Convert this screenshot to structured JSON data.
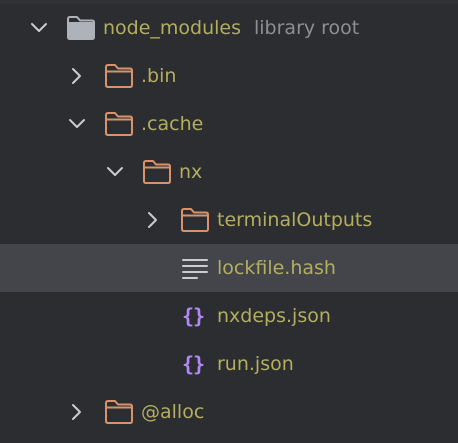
{
  "tree": {
    "root": {
      "label": "node_modules",
      "hint": "library root",
      "icon": "folder-icon",
      "expanded": true
    },
    "items": [
      {
        "label": ".bin",
        "icon": "folder-icon",
        "expanded": false
      },
      {
        "label": ".cache",
        "icon": "folder-icon",
        "expanded": true
      },
      {
        "label": "nx",
        "icon": "folder-icon",
        "expanded": true
      },
      {
        "label": "terminalOutputs",
        "icon": "folder-icon",
        "expanded": false
      },
      {
        "label": "lockfile.hash",
        "icon": "text-file-icon",
        "selected": true
      },
      {
        "label": "nxdeps.json",
        "icon": "json-file-icon",
        "glyph": "{}"
      },
      {
        "label": "run.json",
        "icon": "json-file-icon",
        "glyph": "{}"
      },
      {
        "label": "@alloc",
        "icon": "folder-icon",
        "expanded": false
      }
    ]
  },
  "colors": {
    "background": "#2b2d30",
    "selected_row": "#43454a",
    "label": "#b3ae60",
    "hint": "#8c8f94",
    "root_folder_icon": "#aeb3ba",
    "folder_icon": "#d9926a",
    "json_icon": "#b189f5",
    "chevron": "#c9ccd1"
  }
}
